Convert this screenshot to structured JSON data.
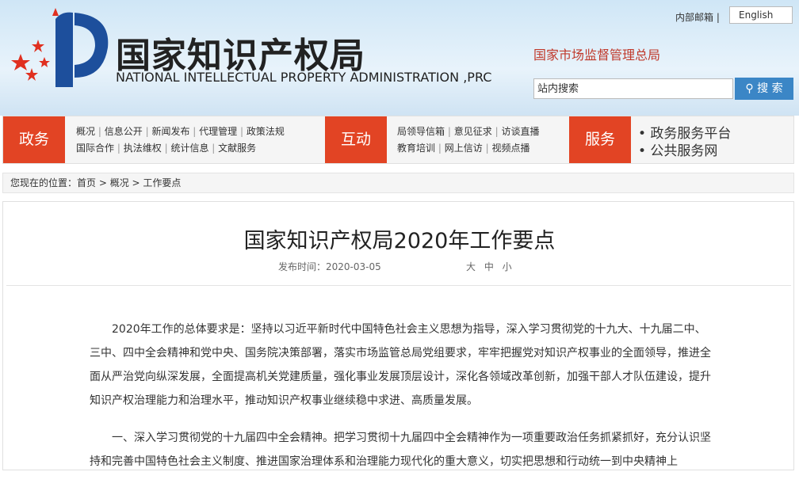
{
  "header": {
    "title_cn": "国家知识产权局",
    "title_en": "NATIONAL INTELLECTUAL PROPERTY ADMINISTRATION ,PRC",
    "internal_mail": "内部邮箱 |",
    "language": "English",
    "parent_agency": "国家市场监督管理总局",
    "search_placeholder": "站内搜索",
    "search_button": "搜 索"
  },
  "nav": {
    "zhengwu": "政务",
    "zw_links": [
      [
        "概况",
        "信息公开",
        "新闻发布",
        "代理管理",
        "政策法规"
      ],
      [
        "国际合作",
        "执法维权",
        "统计信息",
        "文献服务"
      ]
    ],
    "hudong": "互动",
    "hd_links": [
      [
        "局领导信箱",
        "意见征求",
        "访谈直播"
      ],
      [
        "教育培训",
        "网上信访",
        "视频点播"
      ]
    ],
    "fuwu": "服务",
    "fw": [
      "• 政务服务平台",
      "• 公共服务网"
    ]
  },
  "crumb": {
    "label": "您现在的位置：",
    "items": [
      "首页",
      "概况",
      "工作要点"
    ]
  },
  "article": {
    "title": "国家知识产权局2020年工作要点",
    "pub": "发布时间：2020-03-05",
    "sizes": "大 中 小",
    "paragraphs": [
      "2020年工作的总体要求是：坚持以习近平新时代中国特色社会主义思想为指导，深入学习贯彻党的十九大、十九届二中、三中、四中全会精神和党中央、国务院决策部署，落实市场监管总局党组要求，牢牢把握党对知识产权事业的全面领导，推进全面从严治党向纵深发展，全面提高机关党建质量，强化事业发展顶层设计，深化各领域改革创新，加强干部人才队伍建设，提升知识产权治理能力和治理水平，推动知识产权事业继续稳中求进、高质量发展。",
      "一、深入学习贯彻党的十九届四中全会精神。把学习贯彻十九届四中全会精神作为一项重要政治任务抓紧抓好，充分认识坚持和完善中国特色社会主义制度、推进国家治理体系和治理能力现代化的重大意义，切实把思想和行动统一到中央精神上"
    ]
  }
}
